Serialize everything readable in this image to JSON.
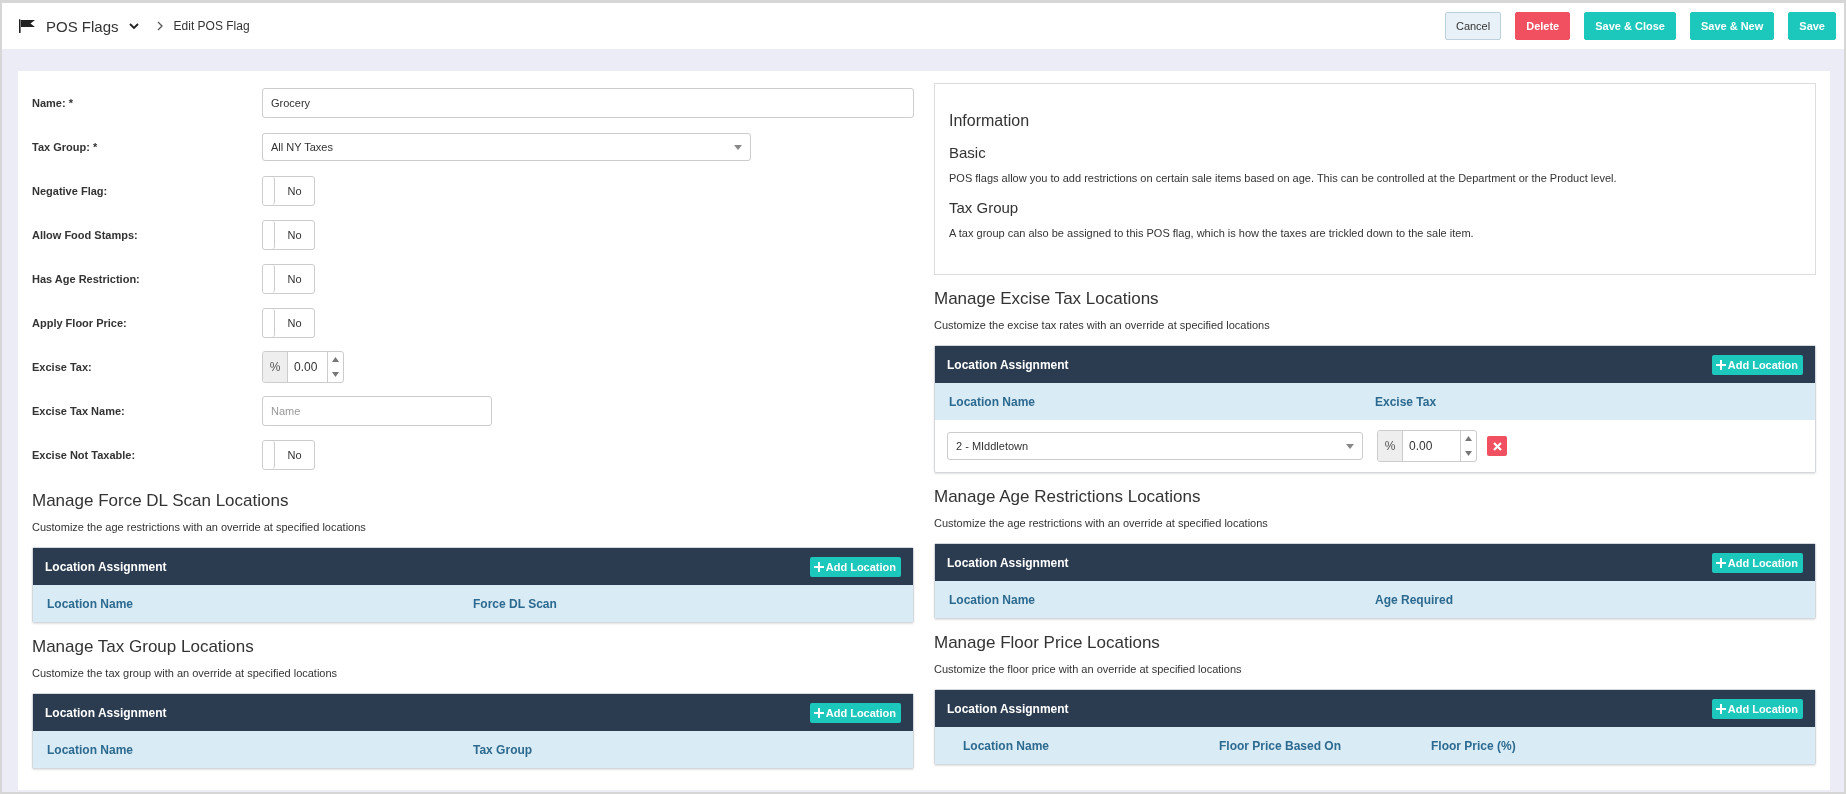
{
  "header": {
    "title": "POS Flags",
    "breadcrumb": "Edit POS Flag",
    "buttons": [
      {
        "label": "Cancel",
        "kind": "default"
      },
      {
        "label": "Delete",
        "kind": "danger"
      },
      {
        "label": "Save & Close",
        "kind": "primary"
      },
      {
        "label": "Save & New",
        "kind": "primary"
      },
      {
        "label": "Save",
        "kind": "primary"
      }
    ]
  },
  "form": {
    "fields": [
      {
        "kind": "text",
        "label": "Name: *",
        "value": "Grocery"
      },
      {
        "kind": "select",
        "label": "Tax Group: *",
        "value": "All NY Taxes"
      },
      {
        "kind": "toggle",
        "label": "Negative Flag:",
        "value": "No",
        "on": false
      },
      {
        "kind": "toggle",
        "label": "Allow Food Stamps:",
        "value": "No",
        "on": false
      },
      {
        "kind": "toggle",
        "label": "Has Age Restriction:",
        "value": "No",
        "on": false
      },
      {
        "kind": "toggle",
        "label": "Apply Floor Price:",
        "value": "No",
        "on": false
      },
      {
        "kind": "percent",
        "label": "Excise Tax:",
        "unit": "%",
        "value": "0.00"
      },
      {
        "kind": "short-text",
        "label": "Excise Tax Name:",
        "placeholder": "Name"
      },
      {
        "kind": "toggle",
        "label": "Excise Not Taxable:",
        "value": "No",
        "on": false
      }
    ]
  },
  "information": {
    "title": "Information",
    "sections": [
      {
        "heading": "Basic",
        "text": "POS flags allow you to add restrictions on certain sale items based on age. This can be controlled at the Department or the Product level."
      },
      {
        "heading": "Tax Group",
        "text": "A tax group can also be assigned to this POS flag, which is how the taxes are trickled down to the sale item."
      }
    ]
  },
  "left_sections": [
    {
      "title": "Manage Force DL Scan Locations",
      "description": "Customize the age restrictions with an override at specified locations",
      "table": {
        "header": "Location Assignment",
        "add_button": "Add Location",
        "columns": [
          "Location Name",
          "Force DL Scan"
        ]
      }
    },
    {
      "title": "Manage Tax Group Locations",
      "description": "Customize the tax group with an override at specified locations",
      "table": {
        "header": "Location Assignment",
        "add_button": "Add Location",
        "columns": [
          "Location Name",
          "Tax Group"
        ]
      }
    }
  ],
  "right_sections": [
    {
      "title": "Manage Excise Tax Locations",
      "description": "Customize the excise tax rates with an override at specified locations",
      "table": {
        "header": "Location Assignment",
        "add_button": "Add Location",
        "columns": [
          "Location Name",
          "Excise Tax"
        ],
        "rows": [
          {
            "location": "2 - MIddletown",
            "unit": "%",
            "value": "0.00"
          }
        ]
      }
    },
    {
      "title": "Manage Age Restrictions Locations",
      "description": "Customize the age restrictions with an override at specified locations",
      "table": {
        "header": "Location Assignment",
        "add_button": "Add Location",
        "columns": [
          "Location Name",
          "Age Required"
        ]
      }
    },
    {
      "title": "Manage Floor Price Locations",
      "description": "Customize the floor price with an override at specified locations",
      "table": {
        "header": "Location Assignment",
        "add_button": "Add Location",
        "columns": [
          "Location Name",
          "Floor Price Based On",
          "Floor Price (%)"
        ]
      }
    }
  ]
}
